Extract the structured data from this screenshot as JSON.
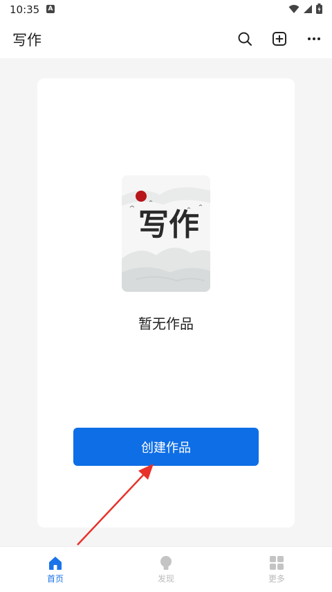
{
  "status_bar": {
    "time": "10:35",
    "notification_icon": "A"
  },
  "header": {
    "title": "写作",
    "icons": [
      "search-icon",
      "add-square-icon",
      "more-icon"
    ]
  },
  "main": {
    "cover_title": "写作",
    "empty_text": "暂无作品",
    "create_button_label": "创建作品"
  },
  "bottom_nav": {
    "items": [
      {
        "label": "首页",
        "icon": "home-icon",
        "active": true
      },
      {
        "label": "发现",
        "icon": "discover-icon",
        "active": false
      },
      {
        "label": "更多",
        "icon": "grid-icon",
        "active": false
      }
    ]
  },
  "colors": {
    "accent": "#0e6ee6",
    "active_nav": "#1a73e8",
    "inactive_nav": "#bbbbbb",
    "annotation_arrow": "#e8312a"
  }
}
